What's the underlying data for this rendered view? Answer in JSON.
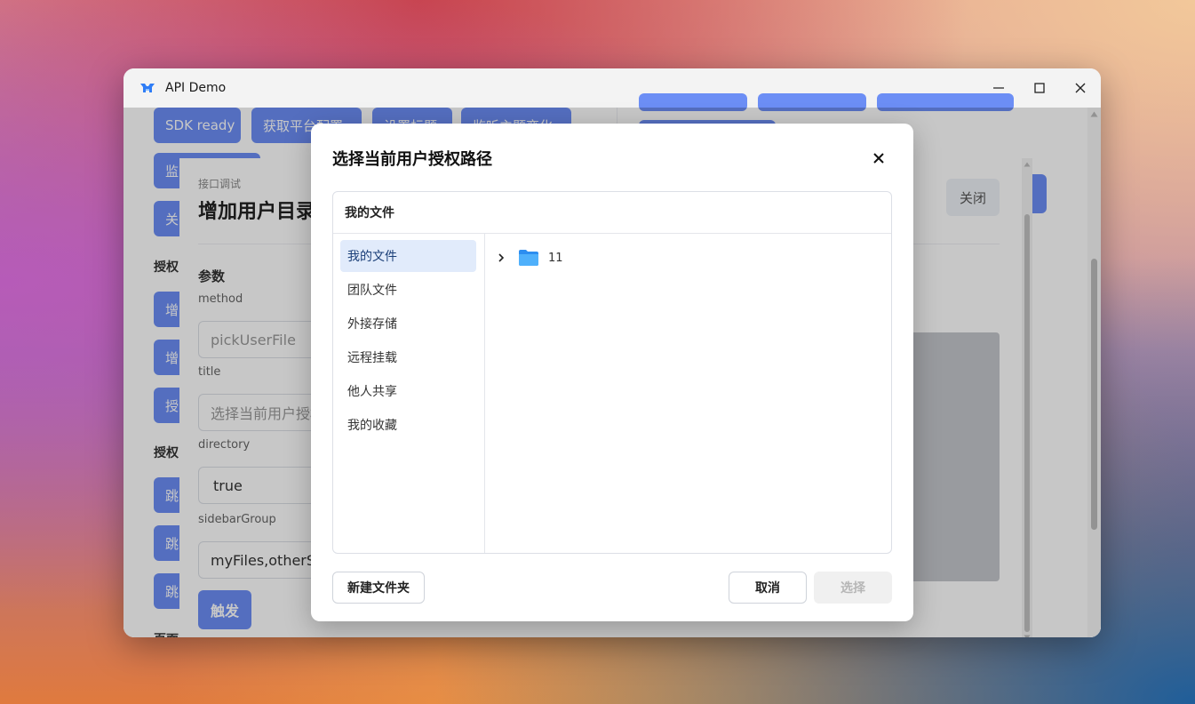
{
  "window": {
    "title": "API Demo"
  },
  "app": {
    "pills_row1": [
      "SDK ready",
      "获取平台配置",
      "设置标题",
      "监听主题变化"
    ],
    "pills_right_row1": [
      "",
      "",
      ""
    ],
    "pills_left": [
      "监",
      "关",
      "增",
      "增",
      "授",
      "跳",
      "跳",
      "跳"
    ],
    "section_auth": "授权",
    "section_auth2": "授权",
    "section_page_route": "页面路由"
  },
  "debug_panel": {
    "small_label": "接口调试",
    "title": "增加用户目录",
    "close_label": "关闭",
    "params_heading": "参数",
    "fields": [
      {
        "label": "method",
        "value": "pickUserFile"
      },
      {
        "label": "title",
        "value": "选择当前用户授权路径"
      },
      {
        "label": "directory",
        "value": "true"
      },
      {
        "label": "sidebarGroup",
        "value": "myFiles,otherShared"
      }
    ],
    "trigger_label": "触发"
  },
  "dialog": {
    "title": "选择当前用户授权路径",
    "path": "我的文件",
    "sidebar": [
      "我的文件",
      "团队文件",
      "外接存储",
      "远程挂载",
      "他人共享",
      "我的收藏"
    ],
    "active_sidebar_index": 0,
    "tree": [
      {
        "name": "11",
        "icon": "folder-icon",
        "expandable": true
      }
    ],
    "buttons": {
      "new_folder": "新建文件夹",
      "cancel": "取消",
      "select": "选择"
    }
  },
  "colors": {
    "accent": "#6c8ef5",
    "active_item_bg": "#e1ebfb",
    "folder": "#3aa0f5"
  }
}
